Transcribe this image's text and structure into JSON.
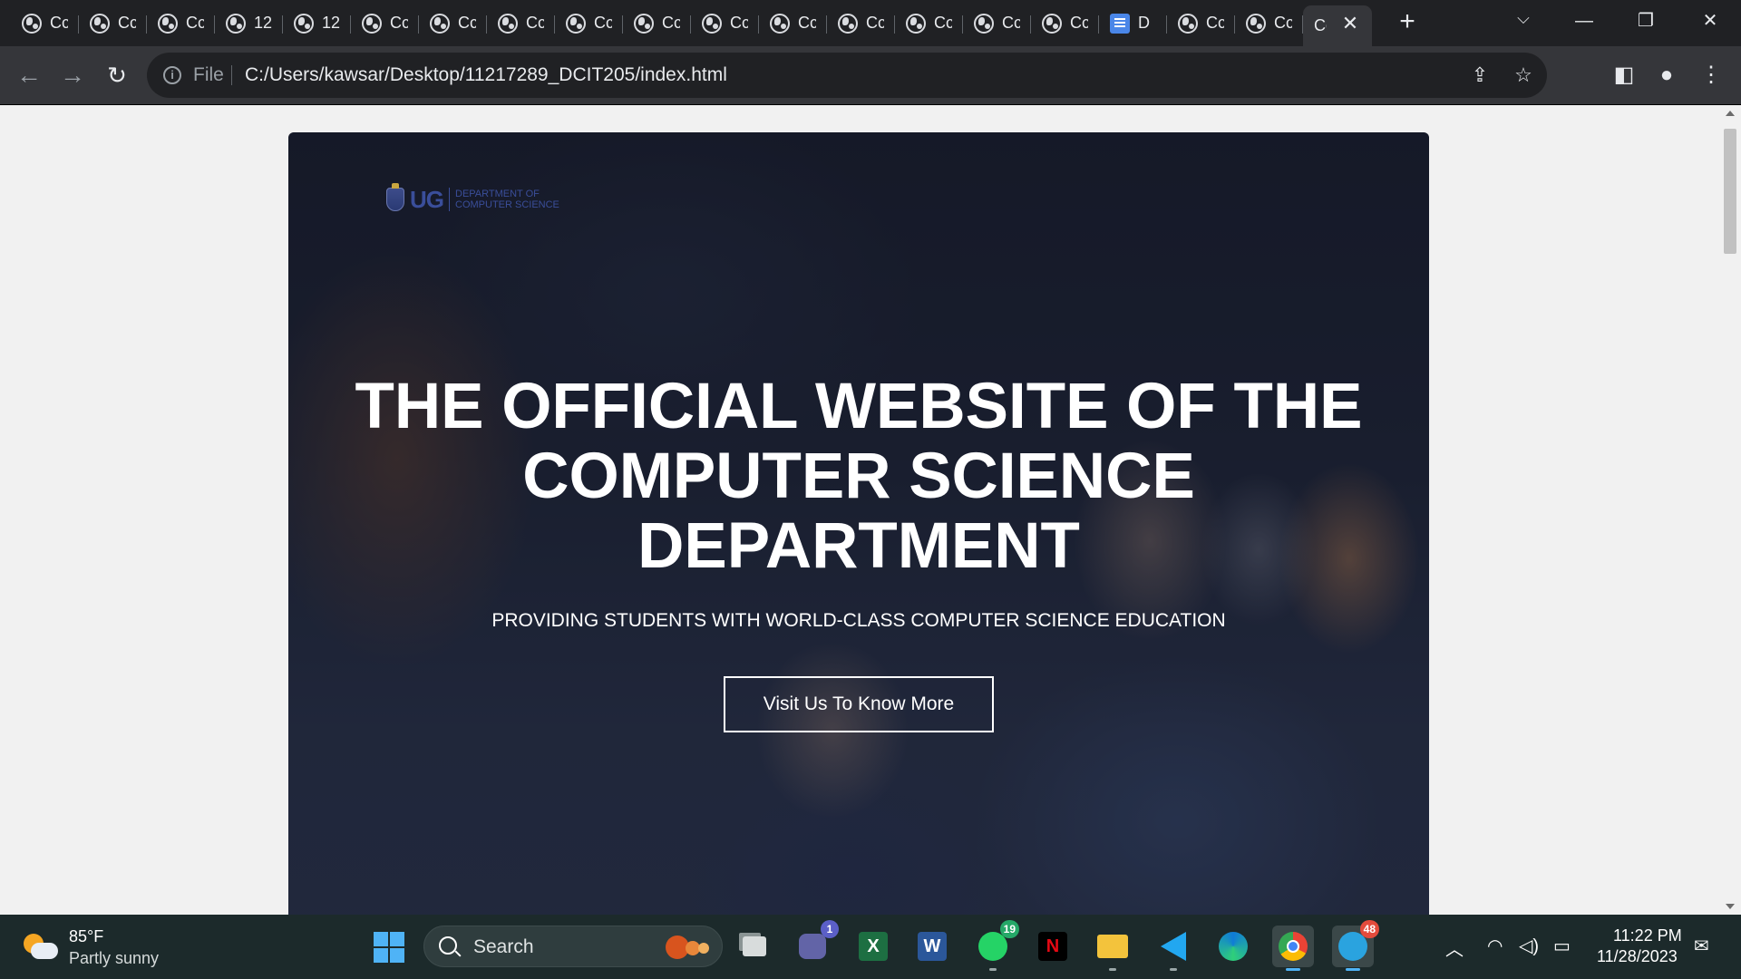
{
  "browser": {
    "tabs": [
      {
        "title": "Cc",
        "icon": "globe-icon"
      },
      {
        "title": "Cc",
        "icon": "globe-icon"
      },
      {
        "title": "Cc",
        "icon": "globe-icon"
      },
      {
        "title": "12",
        "icon": "globe-icon"
      },
      {
        "title": "12",
        "icon": "globe-icon"
      },
      {
        "title": "Cc",
        "icon": "globe-icon"
      },
      {
        "title": "Cc",
        "icon": "globe-icon"
      },
      {
        "title": "Cc",
        "icon": "globe-icon"
      },
      {
        "title": "Cc",
        "icon": "globe-icon"
      },
      {
        "title": "Cc",
        "icon": "globe-icon"
      },
      {
        "title": "Cc",
        "icon": "globe-icon"
      },
      {
        "title": "Cc",
        "icon": "globe-icon"
      },
      {
        "title": "Cc",
        "icon": "globe-icon"
      },
      {
        "title": "Cc",
        "icon": "globe-icon"
      },
      {
        "title": "Cc",
        "icon": "globe-icon"
      },
      {
        "title": "Cc",
        "icon": "globe-icon"
      },
      {
        "title": "D",
        "icon": "docs-icon"
      },
      {
        "title": "Cc",
        "icon": "globe-icon"
      },
      {
        "title": "Cc",
        "icon": "globe-icon"
      },
      {
        "title": "Cc",
        "icon": "globe-icon",
        "active": true
      }
    ],
    "new_tab_label": "+",
    "close_tab_label": "✕",
    "address_scheme": "File",
    "url": "C:/Users/kawsar/Desktop/11217289_DCIT205/index.html"
  },
  "page": {
    "logo": {
      "short": "UG",
      "department": "DEPARTMENT OF COMPUTER SCIENCE"
    },
    "hero": {
      "title": "THE OFFICIAL WEBSITE OF THE COMPUTER SCIENCE DEPARTMENT",
      "subtitle": "PROVIDING STUDENTS WITH WORLD-CLASS COMPUTER SCIENCE EDUCATION",
      "button_label": "Visit Us To Know More"
    }
  },
  "taskbar": {
    "weather": {
      "temp": "85°F",
      "desc": "Partly sunny"
    },
    "search_label": "Search",
    "apps": [
      {
        "name": "task-view",
        "label": ""
      },
      {
        "name": "teams",
        "label": "",
        "badge": "1"
      },
      {
        "name": "excel",
        "label": "X"
      },
      {
        "name": "word",
        "label": "W"
      },
      {
        "name": "whatsapp",
        "label": "",
        "badge": "19"
      },
      {
        "name": "netflix",
        "label": "N"
      },
      {
        "name": "file-explorer",
        "label": ""
      },
      {
        "name": "vscode",
        "label": ""
      },
      {
        "name": "edge",
        "label": ""
      },
      {
        "name": "chrome",
        "label": ""
      },
      {
        "name": "telegram",
        "label": "",
        "badge": "48"
      }
    ],
    "clock": {
      "time": "11:22 PM",
      "date": "11/28/2023"
    }
  },
  "colors": {
    "accent": "#4fb3f6",
    "tab_strip": "#202124",
    "toolbar": "#35363a",
    "taskbar": "#1c2a2b"
  }
}
